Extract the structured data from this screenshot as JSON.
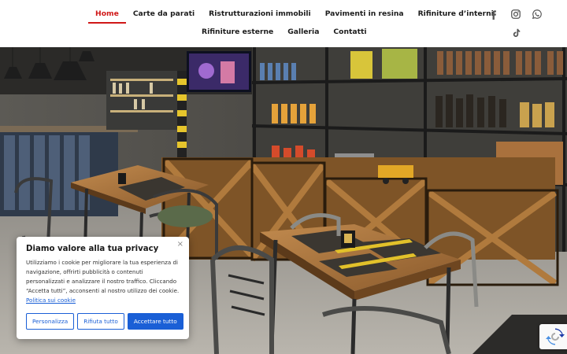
{
  "nav": {
    "row1": [
      "Home",
      "Carte da parati",
      "Ristrutturazioni immobili",
      "Pavimenti in resina",
      "Rifiniture d’interni"
    ],
    "row2": [
      "Rifiniture esterne",
      "Galleria",
      "Contatti"
    ],
    "active": "Home",
    "active_color": "#d01818"
  },
  "social": [
    "facebook-icon",
    "instagram-icon",
    "whatsapp-icon",
    "tiktok-icon"
  ],
  "cookie": {
    "title": "Diamo valore alla tua privacy",
    "close": "×",
    "text": "Utilizziamo i cookie per migliorare la tua esperienza di navigazione, offrirti pubblicità o contenuti personalizzati e analizzare il nostro traffico. Cliccando “Accetta tutti”, acconsenti al nostro utilizzo dei cookie.",
    "link": "Politica sui cookie",
    "buttons": {
      "customize": "Personalizza",
      "reject": "Rifiuta tutto",
      "accept": "Accettare tutto"
    },
    "accent_color": "#1a5fd6"
  },
  "recaptcha": "recaptcha-icon"
}
